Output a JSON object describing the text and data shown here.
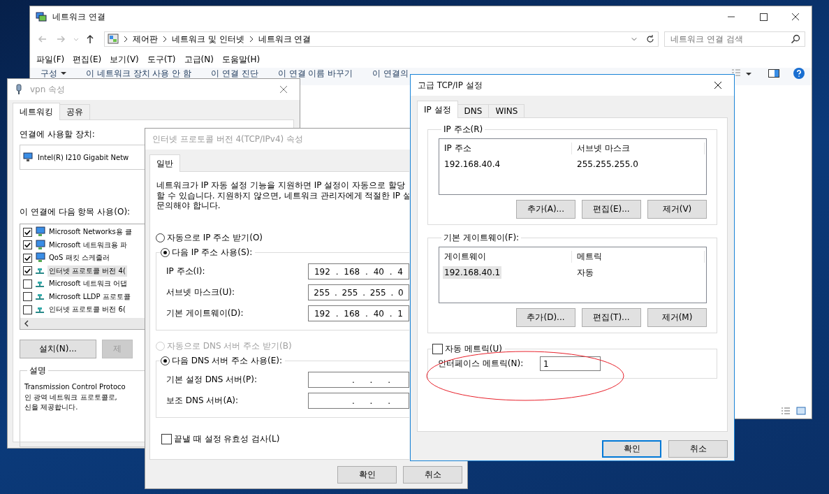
{
  "explorer": {
    "title": "네트워크 연결",
    "breadcrumb": [
      "제어판",
      "네트워크 및 인터넷",
      "네트워크 연결"
    ],
    "search": {
      "placeholder": "네트워크 연결 검색"
    },
    "menu": [
      "파일(F)",
      "편집(E)",
      "보기(V)",
      "도구(T)",
      "고급(N)",
      "도움말(H)"
    ],
    "toolbar": [
      {
        "label": "구성",
        "kind": "dropdown"
      },
      {
        "label": "이 네트워크 장치 사용 안 함",
        "kind": "command"
      },
      {
        "label": "이 연결 진단",
        "kind": "command"
      },
      {
        "label": "이 연결 이름 바꾸기",
        "kind": "command"
      },
      {
        "label": "이 연결의",
        "kind": "command"
      }
    ]
  },
  "vpn_properties": {
    "title": "vpn 속성",
    "tabs": [
      {
        "label": "네트워킹",
        "selected": true
      },
      {
        "label": "공유",
        "selected": false
      }
    ],
    "device_label": "연결에 사용할 장치:",
    "device": "Intel(R) I210 Gigabit Netw",
    "items_label": "이 연결에 다음 항목 사용(O):",
    "items": [
      {
        "label": "Microsoft Networks용 클",
        "kind": "service",
        "checked": true,
        "selected": false
      },
      {
        "label": "Microsoft 네트워크용 파",
        "kind": "service",
        "checked": true,
        "selected": false
      },
      {
        "label": "QoS 패킷 스케줄러",
        "kind": "service",
        "checked": true,
        "selected": false
      },
      {
        "label": "인터넷 프로토콜 버전 4(",
        "kind": "protocol",
        "checked": true,
        "selected": true
      },
      {
        "label": "Microsoft 네트워크 어댑",
        "kind": "protocol",
        "checked": false,
        "selected": false
      },
      {
        "label": "Microsoft LLDP 프로토콜",
        "kind": "protocol",
        "checked": false,
        "selected": false
      },
      {
        "label": "인터넷 프로토콜 버전 6(",
        "kind": "protocol",
        "checked": false,
        "selected": false
      }
    ],
    "buttons": [
      {
        "label": "설치(N)...",
        "disabled": false
      },
      {
        "label": "제",
        "disabled": true
      }
    ],
    "description_title": "설명",
    "description": "Transmission Control Protoco\n인 광역 네트워크 프로토콜로,\n신을 제공합니다."
  },
  "ipv4_properties": {
    "title": "인터넷 프로토콜 버전 4(TCP/IPv4) 속성",
    "tabs": [
      {
        "label": "일반",
        "selected": true
      }
    ],
    "intro": "네트워크가 IP 자동 설정 기능을 지원하면 IP 설정이 자동으로 할당\n할 수 있습니다. 지원하지 않으면, 네트워크 관리자에게 적절한 IP 설\n문의해야 합니다.",
    "ip_options": [
      {
        "label": "자동으로 IP 주소 받기(O)",
        "selected": false,
        "disabled": false
      },
      {
        "label": "다음 IP 주소 사용(S):",
        "selected": true,
        "disabled": false
      }
    ],
    "ip_fields": [
      {
        "label": "IP 주소(I):",
        "parts": [
          "192",
          ".",
          "168",
          ".",
          "40",
          ".",
          "4"
        ]
      },
      {
        "label": "서브넷 마스크(U):",
        "parts": [
          "255",
          ".",
          "255",
          ".",
          "255",
          ".",
          "0"
        ]
      },
      {
        "label": "기본 게이트웨이(D):",
        "parts": [
          "192",
          ".",
          "168",
          ".",
          "40",
          ".",
          "1"
        ]
      }
    ],
    "dns_options": [
      {
        "label": "자동으로 DNS 서버 주소 받기(B)",
        "selected": false,
        "disabled": true
      },
      {
        "label": "다음 DNS 서버 주소 사용(E):",
        "selected": true,
        "disabled": false
      }
    ],
    "dns_fields": [
      {
        "label": "기본 설정 DNS 서버(P):",
        "parts": [
          ".",
          ".",
          "."
        ]
      },
      {
        "label": "보조 DNS 서버(A):",
        "parts": [
          ".",
          ".",
          "."
        ]
      }
    ],
    "validate": {
      "label": "끝낼 때 설정 유효성 검사(L)",
      "checked": false
    },
    "buttons": [
      {
        "label": "확인",
        "default": false
      },
      {
        "label": "취소",
        "default": false
      }
    ]
  },
  "advanced_tcpip": {
    "title": "고급 TCP/IP 설정",
    "tabs": [
      {
        "label": "IP 설정",
        "selected": true
      },
      {
        "label": "DNS",
        "selected": false
      },
      {
        "label": "WINS",
        "selected": false
      }
    ],
    "groups": [
      {
        "title": "IP 주소(R)",
        "columns": [
          "IP 주소",
          "서브넷 마스크"
        ],
        "rows": [
          {
            "cells": [
              "192.168.40.4",
              "255.255.255.0"
            ],
            "selected": false
          }
        ],
        "buttons": [
          "추가(A)...",
          "편집(E)...",
          "제거(V)"
        ]
      },
      {
        "title": "기본 게이트웨이(F):",
        "columns": [
          "게이트웨이",
          "메트릭"
        ],
        "rows": [
          {
            "cells": [
              "192.168.40.1",
              "자동"
            ],
            "selected": true
          }
        ],
        "buttons": [
          "추가(D)...",
          "편집(T)...",
          "제거(M)"
        ]
      }
    ],
    "auto_metric": {
      "label": "자동 메트릭(U)",
      "checked": false
    },
    "interface_metric": {
      "label": "인터페이스 메트릭(N):",
      "value": "1"
    },
    "buttons": [
      {
        "label": "확인",
        "default": true
      },
      {
        "label": "취소",
        "default": false
      }
    ]
  }
}
